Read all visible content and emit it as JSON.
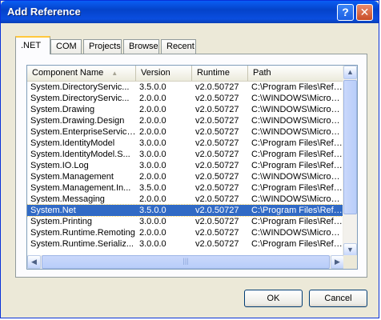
{
  "window": {
    "title": "Add Reference",
    "help": "?",
    "close": "✕"
  },
  "tabs": [
    ".NET",
    "COM",
    "Projects",
    "Browse",
    "Recent"
  ],
  "columns": [
    "Component Name",
    "Version",
    "Runtime",
    "Path"
  ],
  "rows": [
    [
      "System.DirectoryServic...",
      "3.5.0.0",
      "v2.0.50727",
      "C:\\Program Files\\Refer..."
    ],
    [
      "System.DirectoryServic...",
      "2.0.0.0",
      "v2.0.50727",
      "C:\\WINDOWS\\Microsof..."
    ],
    [
      "System.Drawing",
      "2.0.0.0",
      "v2.0.50727",
      "C:\\WINDOWS\\Microsof..."
    ],
    [
      "System.Drawing.Design",
      "2.0.0.0",
      "v2.0.50727",
      "C:\\WINDOWS\\Microsof..."
    ],
    [
      "System.EnterpriseServices",
      "2.0.0.0",
      "v2.0.50727",
      "C:\\WINDOWS\\Microsof..."
    ],
    [
      "System.IdentityModel",
      "3.0.0.0",
      "v2.0.50727",
      "C:\\Program Files\\Refer..."
    ],
    [
      "System.IdentityModel.S...",
      "3.0.0.0",
      "v2.0.50727",
      "C:\\Program Files\\Refer..."
    ],
    [
      "System.IO.Log",
      "3.0.0.0",
      "v2.0.50727",
      "C:\\Program Files\\Refer..."
    ],
    [
      "System.Management",
      "2.0.0.0",
      "v2.0.50727",
      "C:\\WINDOWS\\Microsof..."
    ],
    [
      "System.Management.In...",
      "3.5.0.0",
      "v2.0.50727",
      "C:\\Program Files\\Refer..."
    ],
    [
      "System.Messaging",
      "2.0.0.0",
      "v2.0.50727",
      "C:\\WINDOWS\\Microsof..."
    ],
    [
      "System.Net",
      "3.5.0.0",
      "v2.0.50727",
      "C:\\Program Files\\Refer..."
    ],
    [
      "System.Printing",
      "3.0.0.0",
      "v2.0.50727",
      "C:\\Program Files\\Refer..."
    ],
    [
      "System.Runtime.Remoting",
      "2.0.0.0",
      "v2.0.50727",
      "C:\\WINDOWS\\Microsof..."
    ],
    [
      "System.Runtime.Serializ...",
      "3.0.0.0",
      "v2.0.50727",
      "C:\\Program Files\\Refer..."
    ]
  ],
  "selected_row": 11,
  "buttons": {
    "ok": "OK",
    "cancel": "Cancel"
  },
  "colors": {
    "title_bar": "#0a5ef5",
    "selection": "#316ac5",
    "dialog_bg": "#ece9d8"
  }
}
